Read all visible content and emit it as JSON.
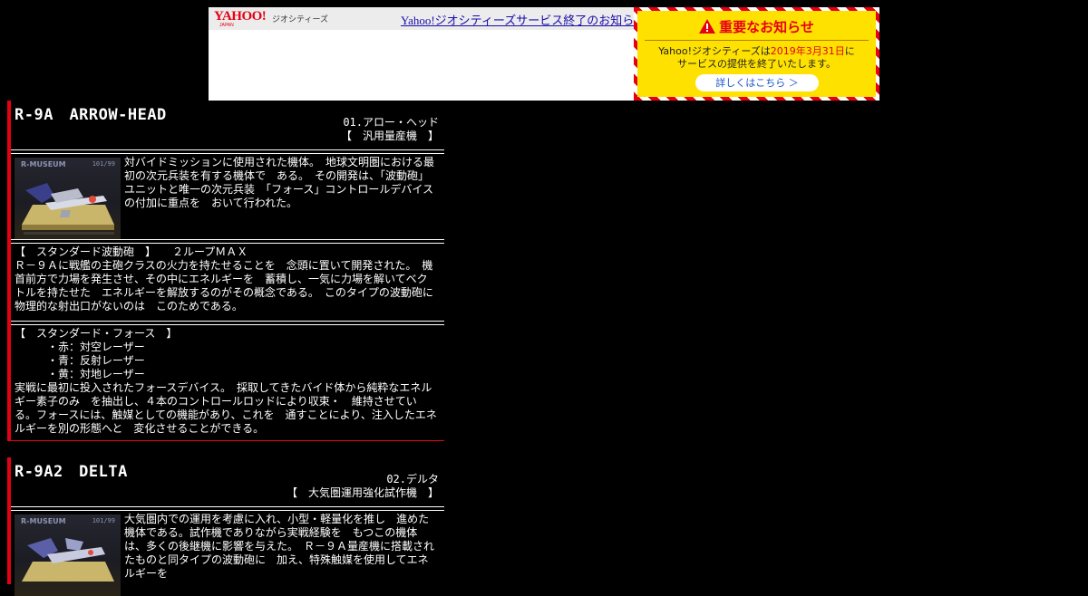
{
  "banner": {
    "logo": "YAHOO!",
    "logo_sub": "JAPAN",
    "service_name": "ジオシティーズ",
    "link_text": "Yahoo!ジオシティーズサービス終了のお知らせ",
    "notice_title": "重要なお知らせ",
    "notice_line1_a": "Yahoo!ジオシティーズは",
    "notice_line1_date": "2019年3月31日",
    "notice_line1_b": "に",
    "notice_line2": "サービスの提供を終了いたします。",
    "notice_button": "詳しくはこちら ＞",
    "colors": {
      "red": "#e60012",
      "yellow": "#ffe100",
      "link": "#1a0dab"
    }
  },
  "mechs": [
    {
      "title": "R-9A　ARROW-HEAD",
      "number_name": "01.アロー・ヘッド",
      "category": "【　汎用量産機　】",
      "thumb_logo": "R-MUSEUM",
      "thumb_num": "101/99",
      "description": "対バイドミッションに使用された機体。　地球文明圏における最初の次元兵装を有する機体で　ある。　その開発は、「波動砲」ユニットと唯一の次元兵装　「フォース」コントロールデバイスの付加に重点を　おいて行われた。",
      "weapon_heading": "【　スタンダード波動砲　】　　２ループＭＡＸ",
      "weapon_text": "Ｒ－９Ａに戦艦の主砲クラスの火力を持たせることを　念頭に置いて開発された。　機首前方で力場を発生させ、その中にエネルギーを　蓄積し、一気に力場を解いてベクトルを持たせた　エネルギーを解放するのがその概念である。　このタイプの波動砲に物理的な射出口がないのは　このためである。",
      "force_heading": "【　スタンダード・フォース　】",
      "force_lasers": [
        "　　　・赤：対空レーザー",
        "　　　・青：反射レーザー",
        "　　　・黄：対地レーザー"
      ],
      "force_text": "実戦に最初に投入されたフォースデバイス。　採取してきたバイド体から純粋なエネルギー素子のみ　を抽出し、４本のコントロールロッドにより収束・　維持させている。フォースには、触媒としての機能があり、これを　通すことにより、注入したエネルギーを別の形態へと　変化させることができる。"
    },
    {
      "title": "R-9A2　DELTA",
      "number_name": "02.デルタ",
      "category": "【　大気圏運用強化試作機　】",
      "thumb_logo": "R-MUSEUM",
      "thumb_num": "101/99",
      "description": "大気圏内での運用を考慮に入れ、小型・軽量化を推し　進めた機体である。試作機でありながら実戦経験を　もつこの機体は、多くの後継機に影響を与えた。　Ｒ－９Ａ量産機に搭載されたものと同タイプの波動砲に　加え、特殊触媒を使用してエネルギーを"
    }
  ]
}
